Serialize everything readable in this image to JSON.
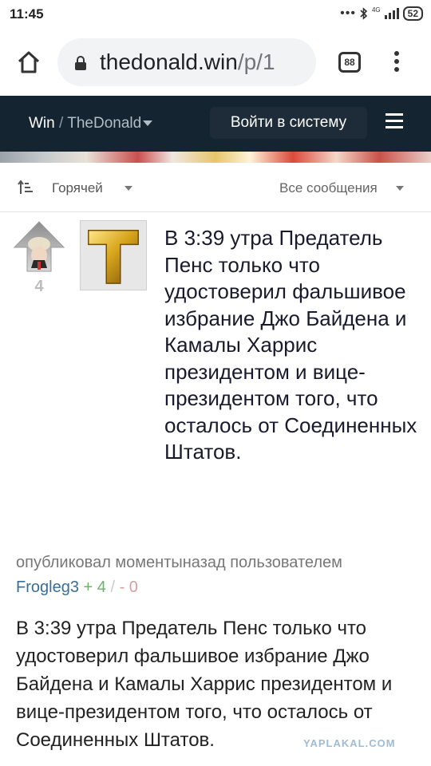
{
  "status_bar": {
    "time": "11:45",
    "network": "4G",
    "battery": "52"
  },
  "browser": {
    "url_domain": "thedonald.win",
    "url_path": "/p/1",
    "tab_count": "88"
  },
  "site_header": {
    "brand": "Win",
    "separator": "/",
    "community": "TheDonald",
    "login_label": "Войти в систему",
    "background_color": "#142431"
  },
  "sort_bar": {
    "sort_label": "Горячей",
    "filter_label": "Все сообщения"
  },
  "post": {
    "score": "4",
    "thumbnail_letter": "T",
    "title": "В 3:39 утра Предатель Пенс только что удостоверил фальшивое избрание Джо Байдена и Камалы Харрис президентом и вице-президентом того, что осталось от Соединенных Штатов.",
    "meta_prefix": "опубликовал моментыназад пользователем",
    "author": "Frogleg3",
    "plus_sign": "+",
    "upvotes": "4",
    "slash": "/",
    "minus_sign": "-",
    "downvotes": "0",
    "body": "В 3:39 утра Предатель Пенс только что удостоверил фальшивое избрание Джо Байдена и Камалы Харрис президентом и вице-президентом того, что осталось от Соединенных Штатов."
  },
  "watermark": "YAPLAKAL.COM"
}
